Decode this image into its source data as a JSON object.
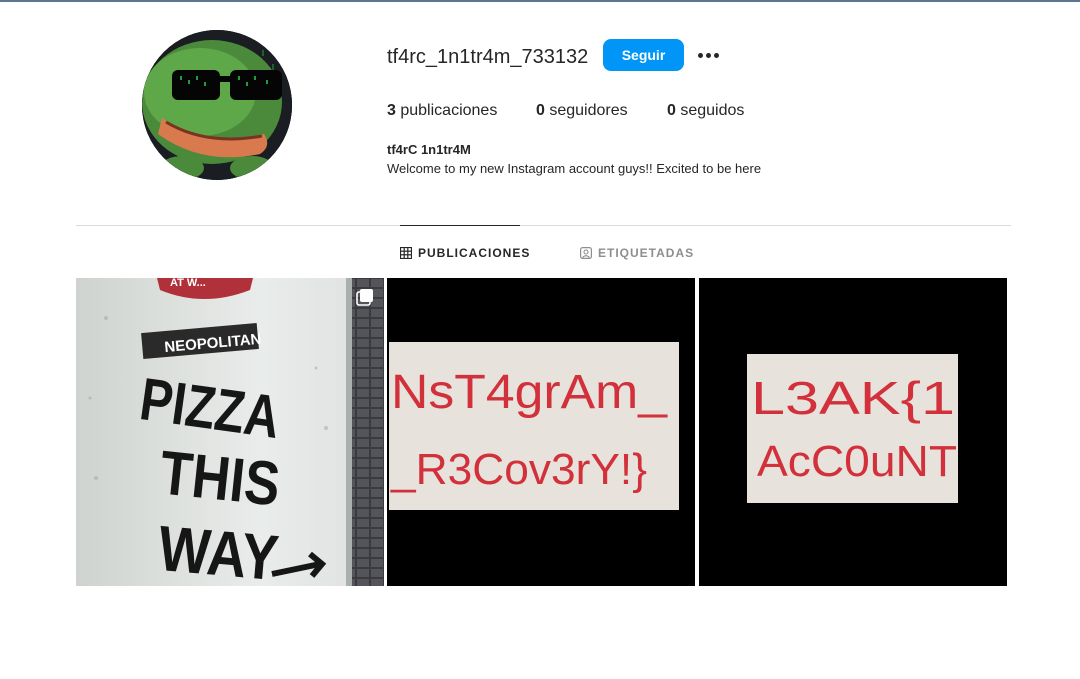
{
  "profile": {
    "username": "tf4rc_1n1tr4m_733132",
    "follow_label": "Seguir",
    "full_name": "tf4rC 1n1tr4M",
    "bio": "Welcome to my new Instagram account guys!! Excited to be here",
    "avatar_icon": "pepe-frog-sunglasses-avatar"
  },
  "stats": [
    {
      "count": "3",
      "label": "publicaciones"
    },
    {
      "count": "0",
      "label": "seguidores"
    },
    {
      "count": "0",
      "label": "seguidos"
    }
  ],
  "tabs": [
    {
      "label": "PUBLICACIONES",
      "icon": "grid-icon",
      "active": true
    },
    {
      "label": "ETIQUETADAS",
      "icon": "tagged-icon",
      "active": false
    }
  ],
  "posts": [
    {
      "kind": "photo",
      "sign_top": "NEOPOLITAN",
      "sign_words": [
        "PIZZA",
        "THIS",
        "WAY"
      ],
      "badge_text": "AT W...",
      "multi": true
    },
    {
      "kind": "note",
      "lines": [
        "NsT4grAm_",
        "_R3Cov3rY!}"
      ]
    },
    {
      "kind": "note",
      "lines": [
        "L3AK{1",
        "AcC0uNT"
      ]
    }
  ],
  "colors": {
    "accent": "#0095f6",
    "text": "#262626",
    "muted": "#8e8e8e",
    "divider": "#dbdbdb",
    "marker_red": "#d2303a"
  }
}
